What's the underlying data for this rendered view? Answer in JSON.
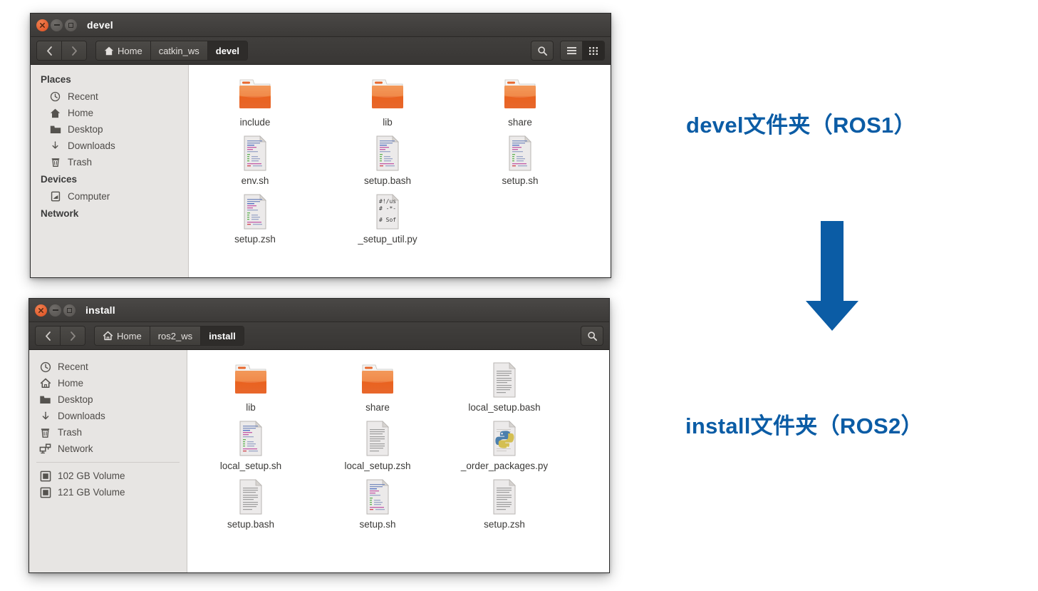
{
  "accent_color": "#0b5ca5",
  "folder_color": "#e8672c",
  "windows": [
    {
      "id": "devel-window",
      "title": "devel",
      "controls": {
        "close": "×",
        "minimize": "–",
        "maximize": "□"
      },
      "nav": {
        "back": "‹",
        "forward": "›"
      },
      "breadcrumbs": [
        {
          "label": "Home",
          "icon": "home-icon",
          "active": false
        },
        {
          "label": "catkin_ws",
          "icon": "",
          "active": false
        },
        {
          "label": "devel",
          "icon": "",
          "active": true
        }
      ],
      "toolbar_right": [
        {
          "name": "search-icon",
          "label": ""
        },
        {
          "name": "list-view-icon",
          "label": ""
        },
        {
          "name": "grid-view-icon",
          "label": ""
        }
      ],
      "sidebar": [
        {
          "type": "header",
          "label": "Places"
        },
        {
          "type": "item",
          "label": "Recent",
          "icon": "clock-icon"
        },
        {
          "type": "item",
          "label": "Home",
          "icon": "home-filled-icon"
        },
        {
          "type": "item",
          "label": "Desktop",
          "icon": "folder-icon"
        },
        {
          "type": "item",
          "label": "Downloads",
          "icon": "download-icon"
        },
        {
          "type": "item",
          "label": "Trash",
          "icon": "trash-icon"
        },
        {
          "type": "header",
          "label": "Devices"
        },
        {
          "type": "item",
          "label": "Computer",
          "icon": "computer-icon"
        },
        {
          "type": "header",
          "label": "Network"
        }
      ],
      "files": [
        {
          "name": "include",
          "type": "folder"
        },
        {
          "name": "lib",
          "type": "folder"
        },
        {
          "name": "share",
          "type": "folder"
        },
        {
          "name": "env.sh",
          "type": "script"
        },
        {
          "name": "setup.bash",
          "type": "script"
        },
        {
          "name": "setup.sh",
          "type": "script"
        },
        {
          "name": "setup.zsh",
          "type": "script"
        },
        {
          "name": "_setup_util.py",
          "type": "text-script"
        }
      ]
    },
    {
      "id": "install-window",
      "title": "install",
      "controls": {
        "close": "×",
        "minimize": "–",
        "maximize": "□"
      },
      "nav": {
        "back": "‹",
        "forward": "›"
      },
      "breadcrumbs": [
        {
          "label": "Home",
          "icon": "home-outline-icon",
          "active": false
        },
        {
          "label": "ros2_ws",
          "icon": "",
          "active": false
        },
        {
          "label": "install",
          "icon": "",
          "active": true
        }
      ],
      "toolbar_right": [
        {
          "name": "search-icon",
          "label": ""
        }
      ],
      "sidebar": [
        {
          "type": "item",
          "label": "Recent",
          "icon": "clock-icon"
        },
        {
          "type": "item",
          "label": "Home",
          "icon": "home-outline-icon"
        },
        {
          "type": "item",
          "label": "Desktop",
          "icon": "folder-icon"
        },
        {
          "type": "item",
          "label": "Downloads",
          "icon": "download-icon"
        },
        {
          "type": "item",
          "label": "Trash",
          "icon": "trash-icon"
        },
        {
          "type": "item",
          "label": "Network",
          "icon": "network-icon"
        },
        {
          "type": "divider",
          "label": ""
        },
        {
          "type": "item",
          "label": "102 GB Volume",
          "icon": "drive-icon"
        },
        {
          "type": "item",
          "label": "121 GB Volume",
          "icon": "drive-icon"
        }
      ],
      "files": [
        {
          "name": "lib",
          "type": "folder"
        },
        {
          "name": "share",
          "type": "folder"
        },
        {
          "name": "local_setup.bash",
          "type": "plain"
        },
        {
          "name": "local_setup.sh",
          "type": "script"
        },
        {
          "name": "local_setup.zsh",
          "type": "plain"
        },
        {
          "name": "_order_packages.py",
          "type": "python"
        },
        {
          "name": "setup.bash",
          "type": "plain"
        },
        {
          "name": "setup.sh",
          "type": "script"
        },
        {
          "name": "setup.zsh",
          "type": "plain"
        }
      ]
    }
  ],
  "annotations": {
    "top_label": "devel文件夹（ROS1）",
    "bottom_label": "install文件夹（ROS2）",
    "arrow": "down-arrow-icon"
  },
  "script_icon_text": {
    "line1": "#!/us",
    "line2": "#  -*-",
    "line3": "# Sof"
  }
}
